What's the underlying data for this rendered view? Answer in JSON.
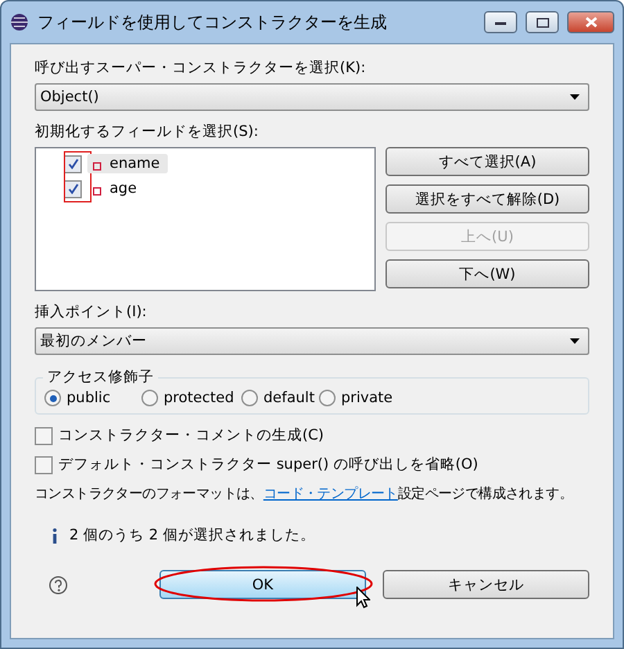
{
  "window": {
    "title": "フィールドを使用してコンストラクターを生成"
  },
  "super_constructor": {
    "label": "呼び出すスーパー・コンストラクターを選択(K):",
    "value": "Object()"
  },
  "fields": {
    "label": "初期化するフィールドを選択(S):",
    "items": [
      {
        "name": "ename",
        "checked": true,
        "selected": true
      },
      {
        "name": "age",
        "checked": true,
        "selected": false
      }
    ]
  },
  "side_buttons": [
    {
      "label": "すべて選択(A)",
      "disabled": false
    },
    {
      "label": "選択をすべて解除(D)",
      "disabled": false
    },
    {
      "label": "上へ(U)",
      "disabled": true
    },
    {
      "label": "下へ(W)",
      "disabled": false
    }
  ],
  "insertion_point": {
    "label": "挿入ポイント(I):",
    "value": "最初のメンバー"
  },
  "access_modifier": {
    "title": "アクセス修飾子",
    "options": [
      {
        "label": "public",
        "selected": true
      },
      {
        "label": "protected",
        "selected": false
      },
      {
        "label": "default",
        "selected": false
      },
      {
        "label": "private",
        "selected": false
      }
    ]
  },
  "options": [
    {
      "label": "コンストラクター・コメントの生成(C)",
      "checked": false
    },
    {
      "label": "デフォルト・コンストラクター super() の呼び出しを省略(O)",
      "checked": false
    }
  ],
  "format_note": {
    "before": "コンストラクターのフォーマットは、",
    "link": "コード・テンプレート",
    "after": "設定ページで構成されます。"
  },
  "status": "2 個のうち 2 個が選択されました。",
  "footer_buttons": [
    {
      "label": "OK",
      "focused": true
    },
    {
      "label": "キャンセル",
      "focused": false
    }
  ]
}
